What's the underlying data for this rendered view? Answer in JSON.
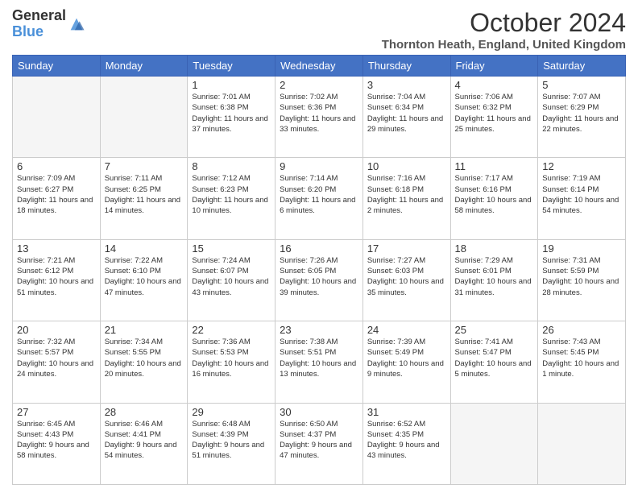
{
  "logo": {
    "general": "General",
    "blue": "Blue"
  },
  "header": {
    "month": "October 2024",
    "location": "Thornton Heath, England, United Kingdom"
  },
  "days": [
    "Sunday",
    "Monday",
    "Tuesday",
    "Wednesday",
    "Thursday",
    "Friday",
    "Saturday"
  ],
  "weeks": [
    [
      {
        "day": null,
        "info": ""
      },
      {
        "day": null,
        "info": ""
      },
      {
        "day": "1",
        "info": "Sunrise: 7:01 AM\nSunset: 6:38 PM\nDaylight: 11 hours and 37 minutes."
      },
      {
        "day": "2",
        "info": "Sunrise: 7:02 AM\nSunset: 6:36 PM\nDaylight: 11 hours and 33 minutes."
      },
      {
        "day": "3",
        "info": "Sunrise: 7:04 AM\nSunset: 6:34 PM\nDaylight: 11 hours and 29 minutes."
      },
      {
        "day": "4",
        "info": "Sunrise: 7:06 AM\nSunset: 6:32 PM\nDaylight: 11 hours and 25 minutes."
      },
      {
        "day": "5",
        "info": "Sunrise: 7:07 AM\nSunset: 6:29 PM\nDaylight: 11 hours and 22 minutes."
      }
    ],
    [
      {
        "day": "6",
        "info": "Sunrise: 7:09 AM\nSunset: 6:27 PM\nDaylight: 11 hours and 18 minutes."
      },
      {
        "day": "7",
        "info": "Sunrise: 7:11 AM\nSunset: 6:25 PM\nDaylight: 11 hours and 14 minutes."
      },
      {
        "day": "8",
        "info": "Sunrise: 7:12 AM\nSunset: 6:23 PM\nDaylight: 11 hours and 10 minutes."
      },
      {
        "day": "9",
        "info": "Sunrise: 7:14 AM\nSunset: 6:20 PM\nDaylight: 11 hours and 6 minutes."
      },
      {
        "day": "10",
        "info": "Sunrise: 7:16 AM\nSunset: 6:18 PM\nDaylight: 11 hours and 2 minutes."
      },
      {
        "day": "11",
        "info": "Sunrise: 7:17 AM\nSunset: 6:16 PM\nDaylight: 10 hours and 58 minutes."
      },
      {
        "day": "12",
        "info": "Sunrise: 7:19 AM\nSunset: 6:14 PM\nDaylight: 10 hours and 54 minutes."
      }
    ],
    [
      {
        "day": "13",
        "info": "Sunrise: 7:21 AM\nSunset: 6:12 PM\nDaylight: 10 hours and 51 minutes."
      },
      {
        "day": "14",
        "info": "Sunrise: 7:22 AM\nSunset: 6:10 PM\nDaylight: 10 hours and 47 minutes."
      },
      {
        "day": "15",
        "info": "Sunrise: 7:24 AM\nSunset: 6:07 PM\nDaylight: 10 hours and 43 minutes."
      },
      {
        "day": "16",
        "info": "Sunrise: 7:26 AM\nSunset: 6:05 PM\nDaylight: 10 hours and 39 minutes."
      },
      {
        "day": "17",
        "info": "Sunrise: 7:27 AM\nSunset: 6:03 PM\nDaylight: 10 hours and 35 minutes."
      },
      {
        "day": "18",
        "info": "Sunrise: 7:29 AM\nSunset: 6:01 PM\nDaylight: 10 hours and 31 minutes."
      },
      {
        "day": "19",
        "info": "Sunrise: 7:31 AM\nSunset: 5:59 PM\nDaylight: 10 hours and 28 minutes."
      }
    ],
    [
      {
        "day": "20",
        "info": "Sunrise: 7:32 AM\nSunset: 5:57 PM\nDaylight: 10 hours and 24 minutes."
      },
      {
        "day": "21",
        "info": "Sunrise: 7:34 AM\nSunset: 5:55 PM\nDaylight: 10 hours and 20 minutes."
      },
      {
        "day": "22",
        "info": "Sunrise: 7:36 AM\nSunset: 5:53 PM\nDaylight: 10 hours and 16 minutes."
      },
      {
        "day": "23",
        "info": "Sunrise: 7:38 AM\nSunset: 5:51 PM\nDaylight: 10 hours and 13 minutes."
      },
      {
        "day": "24",
        "info": "Sunrise: 7:39 AM\nSunset: 5:49 PM\nDaylight: 10 hours and 9 minutes."
      },
      {
        "day": "25",
        "info": "Sunrise: 7:41 AM\nSunset: 5:47 PM\nDaylight: 10 hours and 5 minutes."
      },
      {
        "day": "26",
        "info": "Sunrise: 7:43 AM\nSunset: 5:45 PM\nDaylight: 10 hours and 1 minute."
      }
    ],
    [
      {
        "day": "27",
        "info": "Sunrise: 6:45 AM\nSunset: 4:43 PM\nDaylight: 9 hours and 58 minutes."
      },
      {
        "day": "28",
        "info": "Sunrise: 6:46 AM\nSunset: 4:41 PM\nDaylight: 9 hours and 54 minutes."
      },
      {
        "day": "29",
        "info": "Sunrise: 6:48 AM\nSunset: 4:39 PM\nDaylight: 9 hours and 51 minutes."
      },
      {
        "day": "30",
        "info": "Sunrise: 6:50 AM\nSunset: 4:37 PM\nDaylight: 9 hours and 47 minutes."
      },
      {
        "day": "31",
        "info": "Sunrise: 6:52 AM\nSunset: 4:35 PM\nDaylight: 9 hours and 43 minutes."
      },
      {
        "day": null,
        "info": ""
      },
      {
        "day": null,
        "info": ""
      }
    ]
  ]
}
